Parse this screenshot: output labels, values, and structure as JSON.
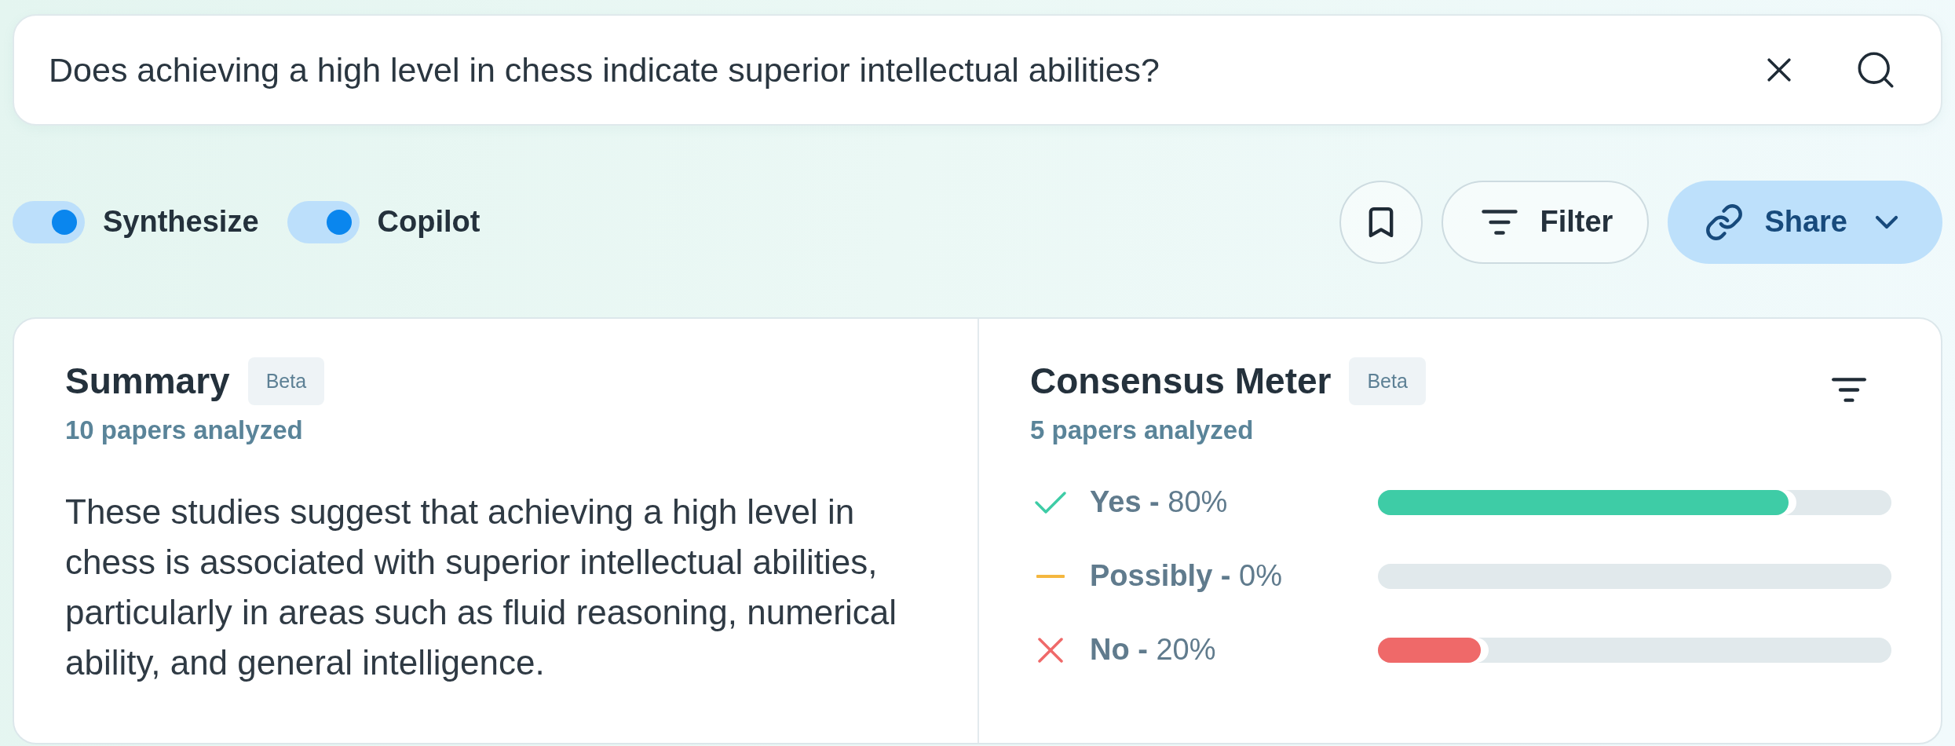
{
  "search": {
    "value": "Does achieving a high level in chess indicate superior intellectual abilities?"
  },
  "toggles": [
    {
      "label": "Synthesize",
      "on": true
    },
    {
      "label": "Copilot",
      "on": true
    }
  ],
  "actions": [
    {
      "kind": "bookmark"
    },
    {
      "kind": "filter",
      "label": "Filter"
    },
    {
      "kind": "share",
      "label": "Share"
    }
  ],
  "summary": {
    "title": "Summary",
    "badge": "Beta",
    "subtitle": "10 papers analyzed",
    "text": "These studies suggest that achieving a high level in chess is associated with superior intellectual abilities, particularly in areas such as fluid reasoning, numerical ability, and general intelligence."
  },
  "consensus_meter": {
    "title": "Consensus Meter",
    "badge": "Beta",
    "subtitle": "5 papers analyzed",
    "rows": [
      {
        "kind": "yes",
        "label": "**Yes -** 80%",
        "color": "#3ecca6",
        "level": 0.8
      },
      {
        "kind": "possibly",
        "label": "**Possibly -** 0%",
        "color": "#f4b73f"
      },
      {
        "kind": "no",
        "label": "**No -** 20%",
        "color": "#ef6969",
        "level": 0.2
      }
    ]
  }
}
